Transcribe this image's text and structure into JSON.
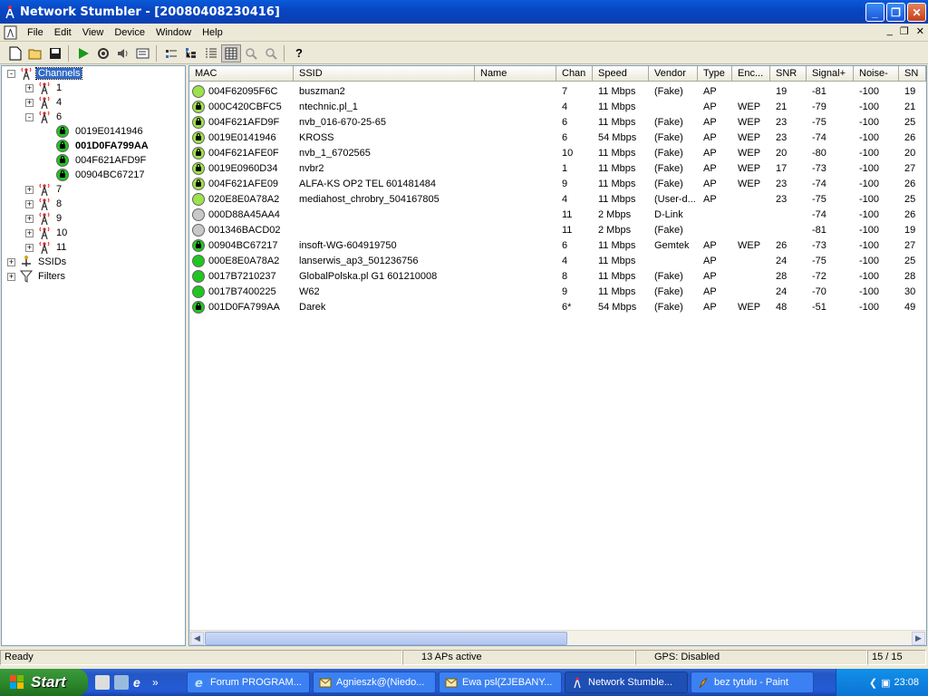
{
  "window": {
    "title": "Network Stumbler - [20080408230416]"
  },
  "menu": [
    "File",
    "Edit",
    "View",
    "Device",
    "Window",
    "Help"
  ],
  "toolbar_icons": [
    "new-icon",
    "open-icon",
    "save-icon",
    "play-icon",
    "auto-config-icon",
    "sound-icon",
    "config-icon",
    "list-icon",
    "tree-icon",
    "details-icon",
    "grid-icon",
    "zoom-in-icon",
    "zoom-out-icon",
    "help-icon"
  ],
  "tree": [
    {
      "label": "Channels",
      "level": 0,
      "expander": "-",
      "icon": "antenna",
      "selected": true
    },
    {
      "label": "1",
      "level": 1,
      "expander": "+",
      "icon": "antenna"
    },
    {
      "label": "4",
      "level": 1,
      "expander": "+",
      "icon": "antenna"
    },
    {
      "label": "6",
      "level": 1,
      "expander": "-",
      "icon": "antenna"
    },
    {
      "label": "0019E0141946",
      "level": 2,
      "icon": "lock"
    },
    {
      "label": "001D0FA799AA",
      "level": 2,
      "icon": "lock",
      "bold": true
    },
    {
      "label": "004F621AFD9F",
      "level": 2,
      "icon": "lock"
    },
    {
      "label": "00904BC67217",
      "level": 2,
      "icon": "lock"
    },
    {
      "label": "7",
      "level": 1,
      "expander": "+",
      "icon": "antenna"
    },
    {
      "label": "8",
      "level": 1,
      "expander": "+",
      "icon": "antenna"
    },
    {
      "label": "9",
      "level": 1,
      "expander": "+",
      "icon": "antenna"
    },
    {
      "label": "10",
      "level": 1,
      "expander": "+",
      "icon": "antenna"
    },
    {
      "label": "11",
      "level": 1,
      "expander": "+",
      "icon": "antenna"
    },
    {
      "label": "SSIDs",
      "level": 0,
      "expander": "+",
      "icon": "ssid"
    },
    {
      "label": "Filters",
      "level": 0,
      "expander": "+",
      "icon": "filter"
    }
  ],
  "columns": [
    "MAC",
    "SSID",
    "Name",
    "Chan",
    "Speed",
    "Vendor",
    "Type",
    "Enc...",
    "SNR",
    "Signal+",
    "Noise-",
    "SN"
  ],
  "rows": [
    {
      "color": "#9ce24a",
      "lock": false,
      "cells": [
        "004F62095F6C",
        "buszman2",
        "",
        "7",
        "11 Mbps",
        "(Fake)",
        "AP",
        "",
        "19",
        "-81",
        "-100",
        "19"
      ]
    },
    {
      "color": "#9ce24a",
      "lock": true,
      "cells": [
        "000C420CBFC5",
        "ntechnic.pl_1",
        "",
        "4",
        "11 Mbps",
        "",
        "AP",
        "WEP",
        "21",
        "-79",
        "-100",
        "21"
      ]
    },
    {
      "color": "#9ce24a",
      "lock": true,
      "cells": [
        "004F621AFD9F",
        "nvb_016-670-25-65",
        "",
        "6",
        "11 Mbps",
        "(Fake)",
        "AP",
        "WEP",
        "23",
        "-75",
        "-100",
        "25"
      ]
    },
    {
      "color": "#9ce24a",
      "lock": true,
      "cells": [
        "0019E0141946",
        "KROSS",
        "",
        "6",
        "54 Mbps",
        "(Fake)",
        "AP",
        "WEP",
        "23",
        "-74",
        "-100",
        "26"
      ]
    },
    {
      "color": "#9ce24a",
      "lock": true,
      "cells": [
        "004F621AFE0F",
        "nvb_1_6702565",
        "",
        "10",
        "11 Mbps",
        "(Fake)",
        "AP",
        "WEP",
        "20",
        "-80",
        "-100",
        "20"
      ]
    },
    {
      "color": "#9ce24a",
      "lock": true,
      "cells": [
        "0019E0960D34",
        "nvbr2",
        "",
        "1",
        "11 Mbps",
        "(Fake)",
        "AP",
        "WEP",
        "17",
        "-73",
        "-100",
        "27"
      ]
    },
    {
      "color": "#9ce24a",
      "lock": true,
      "cells": [
        "004F621AFE09",
        "ALFA-KS OP2 TEL 601481484",
        "",
        "9",
        "11 Mbps",
        "(Fake)",
        "AP",
        "WEP",
        "23",
        "-74",
        "-100",
        "26"
      ]
    },
    {
      "color": "#9ce24a",
      "lock": false,
      "cells": [
        "020E8E0A78A2",
        "mediahost_chrobry_504167805",
        "",
        "4",
        "11 Mbps",
        "(User-d...",
        "AP",
        "",
        "23",
        "-75",
        "-100",
        "25"
      ]
    },
    {
      "color": "#c8c8c8",
      "lock": false,
      "cells": [
        "000D88A45AA4",
        "",
        "",
        "11",
        "2 Mbps",
        "D-Link",
        "",
        "",
        "",
        "-74",
        "-100",
        "26"
      ]
    },
    {
      "color": "#c8c8c8",
      "lock": false,
      "cells": [
        "001346BACD02",
        "",
        "",
        "11",
        "2 Mbps",
        "(Fake)",
        "",
        "",
        "",
        "-81",
        "-100",
        "19"
      ]
    },
    {
      "color": "#22c422",
      "lock": true,
      "cells": [
        "00904BC67217",
        "insoft-WG-604919750",
        "",
        "6",
        "11 Mbps",
        "Gemtek",
        "AP",
        "WEP",
        "26",
        "-73",
        "-100",
        "27"
      ]
    },
    {
      "color": "#22c422",
      "lock": false,
      "cells": [
        "000E8E0A78A2",
        "lanserwis_ap3_501236756",
        "",
        "4",
        "11 Mbps",
        "",
        "AP",
        "",
        "24",
        "-75",
        "-100",
        "25"
      ]
    },
    {
      "color": "#22c422",
      "lock": false,
      "cells": [
        "0017B7210237",
        "GlobalPolska.pl G1 601210008",
        "",
        "8",
        "11 Mbps",
        "(Fake)",
        "AP",
        "",
        "28",
        "-72",
        "-100",
        "28"
      ]
    },
    {
      "color": "#22c422",
      "lock": false,
      "cells": [
        "0017B7400225",
        "W62",
        "",
        "9",
        "11 Mbps",
        "(Fake)",
        "AP",
        "",
        "24",
        "-70",
        "-100",
        "30"
      ]
    },
    {
      "color": "#22c422",
      "lock": true,
      "cells": [
        "001D0FA799AA",
        "Darek",
        "",
        "6*",
        "54 Mbps",
        "(Fake)",
        "AP",
        "WEP",
        "48",
        "-51",
        "-100",
        "49"
      ]
    }
  ],
  "status": {
    "left": "Ready",
    "aps": "13 APs active",
    "gps": "GPS: Disabled",
    "count": "15 / 15"
  },
  "taskbar": {
    "start": "Start",
    "tasks": [
      {
        "label": "Forum PROGRAM...",
        "icon": "ie",
        "active": false
      },
      {
        "label": "Agnieszk@(Niedo...",
        "icon": "mail",
        "active": false
      },
      {
        "label": "Ewa psl(ZJEBANY...",
        "icon": "mail",
        "active": false
      },
      {
        "label": "Network Stumble...",
        "icon": "antenna",
        "active": true
      },
      {
        "label": "bez tytułu - Paint",
        "icon": "paint",
        "active": false
      }
    ],
    "clock": "23:08"
  }
}
